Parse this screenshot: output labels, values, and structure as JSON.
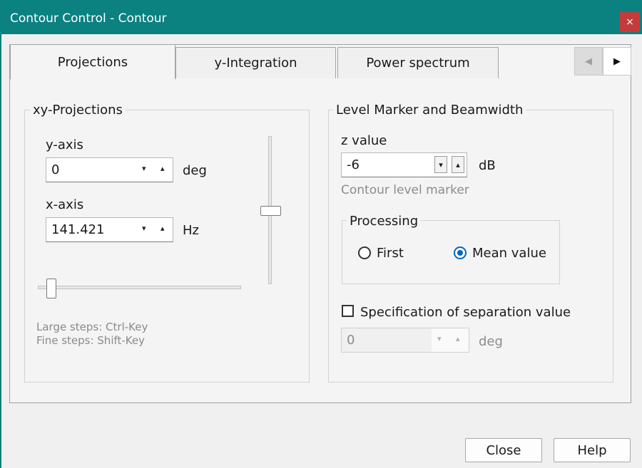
{
  "window": {
    "title": "Contour Control - Contour",
    "close_glyph": "×"
  },
  "tabs": [
    {
      "label": "Projections",
      "active": true
    },
    {
      "label": "y-Integration",
      "active": false
    },
    {
      "label": "Power spectrum",
      "active": false
    }
  ],
  "tab_scroll": {
    "left_glyph": "◀",
    "right_glyph": "▶"
  },
  "xy_projections": {
    "legend": "xy-Projections",
    "y_axis": {
      "label": "y-axis",
      "value": "0",
      "unit": "deg"
    },
    "x_axis": {
      "label": "x-axis",
      "value": "141.421",
      "unit": "Hz"
    },
    "vertical_slider_level": 0.54,
    "horizontal_slider_level": 0.07,
    "hint_large": "Large steps: Ctrl-Key",
    "hint_fine": "Fine steps: Shift-Key"
  },
  "level_marker": {
    "legend": "Level Marker and Beamwidth",
    "z_value": {
      "label": "z value",
      "value": "-6",
      "unit": "dB",
      "caption": "Contour level marker"
    },
    "processing": {
      "legend": "Processing",
      "options": [
        {
          "label": "First",
          "selected": false
        },
        {
          "label": "Mean value",
          "selected": true
        }
      ]
    },
    "separation": {
      "checkbox_label": "Specification of separation value",
      "checked": false,
      "value": "0",
      "unit": "deg"
    }
  },
  "footer": {
    "close_label": "Close",
    "help_label": "Help"
  },
  "colors": {
    "titlebar": "#0b8180",
    "close_button": "#c43b3b",
    "radio_selected": "#0067c0"
  },
  "icons": {
    "spin_down": "▾",
    "spin_up": "▴"
  }
}
